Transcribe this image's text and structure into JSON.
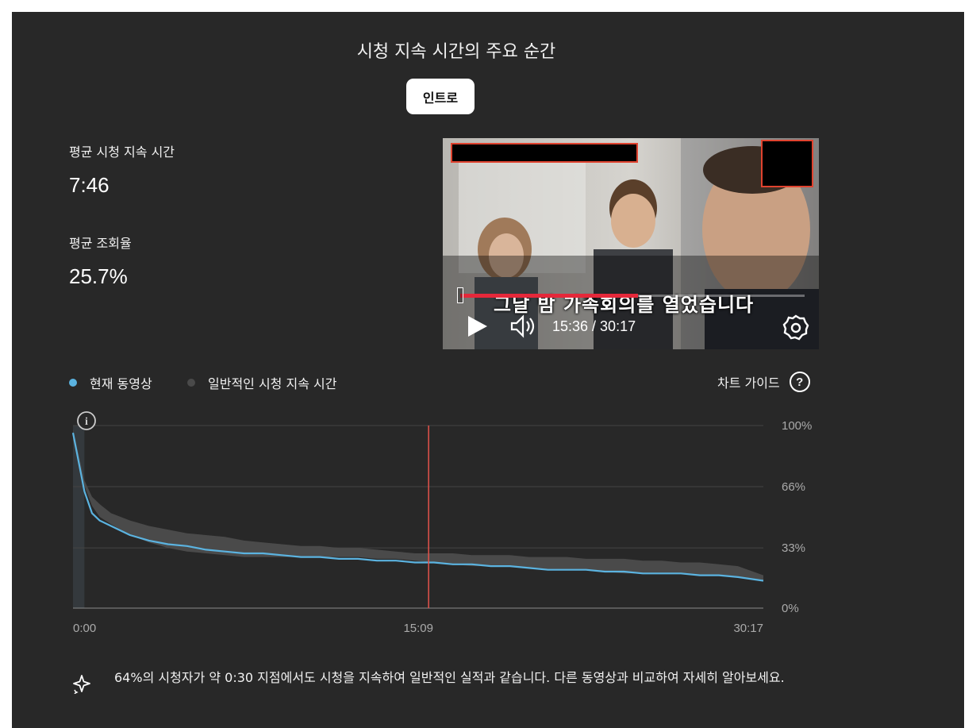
{
  "title": "시청 지속 시간의 주요 순간",
  "chip": {
    "label": "인트로"
  },
  "stats": {
    "avg_view_duration": {
      "label": "평균 시청 지속 시간",
      "value": "7:46"
    },
    "avg_percentage": {
      "label": "평균 조회율",
      "value": "25.7%"
    }
  },
  "video": {
    "caption": "그날 밤 가족회의를 열었습니다",
    "time": "15:36 / 30:17",
    "progress": 0.515,
    "icons": [
      "play-icon",
      "volume-icon",
      "settings-gear-icon"
    ]
  },
  "legend": {
    "current": "현재 동영상",
    "typical": "일반적인 시청 지속 시간",
    "chart_guide": "차트 가이드",
    "help_glyph": "?",
    "colors": {
      "current": "#5bb3e0",
      "typical": "#4a4a4a",
      "marker": "#e5534b"
    }
  },
  "chart_data": {
    "type": "line",
    "xlabel": "",
    "ylabel": "",
    "x_ticks": [
      "0:00",
      "15:09",
      "30:17"
    ],
    "y_ticks": [
      "100%",
      "66%",
      "33%",
      "0%"
    ],
    "xlim_seconds": [
      0,
      1817
    ],
    "ylim": [
      0,
      100
    ],
    "marker_seconds": 936,
    "info_icon": "i",
    "series": [
      {
        "name": "현재 동영상",
        "x": [
          0,
          30,
          50,
          70,
          100,
          150,
          200,
          250,
          300,
          350,
          400,
          450,
          500,
          550,
          600,
          650,
          700,
          750,
          800,
          850,
          900,
          950,
          1000,
          1050,
          1100,
          1150,
          1200,
          1250,
          1300,
          1350,
          1400,
          1450,
          1500,
          1550,
          1600,
          1650,
          1700,
          1750,
          1817
        ],
        "y": [
          96,
          64,
          52,
          48,
          45,
          40,
          37,
          35,
          34,
          32,
          31,
          30,
          30,
          29,
          28,
          28,
          27,
          27,
          26,
          26,
          25,
          25,
          24,
          24,
          23,
          23,
          22,
          21,
          21,
          21,
          20,
          20,
          19,
          19,
          19,
          18,
          18,
          17,
          15
        ]
      },
      {
        "name": "일반적인 시청 지속 시간",
        "y_low": [
          92,
          67,
          56,
          50,
          46,
          40,
          36,
          33,
          31,
          30,
          29,
          28,
          28,
          28,
          28,
          28,
          28,
          28,
          27,
          27,
          26,
          25,
          24,
          23,
          23,
          23,
          22,
          21,
          21,
          21,
          20,
          19,
          19,
          19,
          19,
          18,
          18,
          17,
          15
        ],
        "y_high": [
          98,
          70,
          61,
          57,
          52,
          48,
          45,
          43,
          41,
          40,
          39,
          37,
          36,
          35,
          34,
          34,
          33,
          33,
          32,
          31,
          30,
          30,
          30,
          29,
          29,
          29,
          28,
          28,
          28,
          27,
          27,
          27,
          26,
          26,
          25,
          25,
          24,
          23,
          18
        ]
      }
    ]
  },
  "insight": {
    "icon": "sparkle-icon",
    "text": "64%의 시청자가 약 0:30 지점에서도 시청을 지속하여 일반적인 실적과 같습니다. 다른 동영상과 비교하여 자세히 알아보세요."
  }
}
